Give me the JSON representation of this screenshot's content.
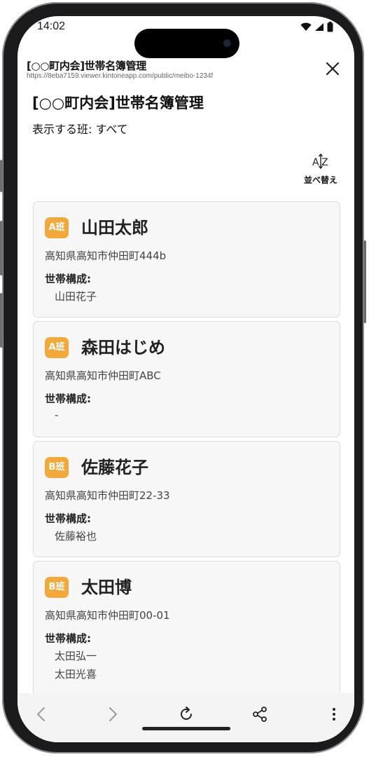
{
  "status": {
    "time": "14:02"
  },
  "browser": {
    "tab_title": "[○○町内会]世帯名簿管理",
    "url": "https://8eba7159.viewer.kintoneapp.com/public/meibo-1234f"
  },
  "app": {
    "title": "[○○町内会]世帯名簿管理",
    "filter_text": "表示する班: すべて",
    "sort_label": "並べ替え",
    "members_heading": "世帯構成:"
  },
  "households": [
    {
      "group": "A班",
      "name": "山田太郎",
      "address": "高知県高知市仲田町444b",
      "members": [
        "山田花子"
      ]
    },
    {
      "group": "A班",
      "name": "森田はじめ",
      "address": "高知県高知市仲田町ABC",
      "members": [
        "-"
      ]
    },
    {
      "group": "B班",
      "name": "佐藤花子",
      "address": "高知県高知市仲田町22-33",
      "members": [
        "佐藤裕也"
      ]
    },
    {
      "group": "B班",
      "name": "太田博",
      "address": "高知県高知市仲田町00-01",
      "members": [
        "太田弘一",
        "太田光喜"
      ]
    }
  ],
  "colors": {
    "badge": "#f2a93b",
    "card_bg": "#f7f7f7",
    "card_border": "#dcdcdc"
  },
  "icons": [
    "wifi-icon",
    "signal-icon",
    "battery-icon",
    "close-icon",
    "sort-az-icon",
    "back-icon",
    "forward-icon",
    "reload-icon",
    "share-icon",
    "more-icon"
  ]
}
